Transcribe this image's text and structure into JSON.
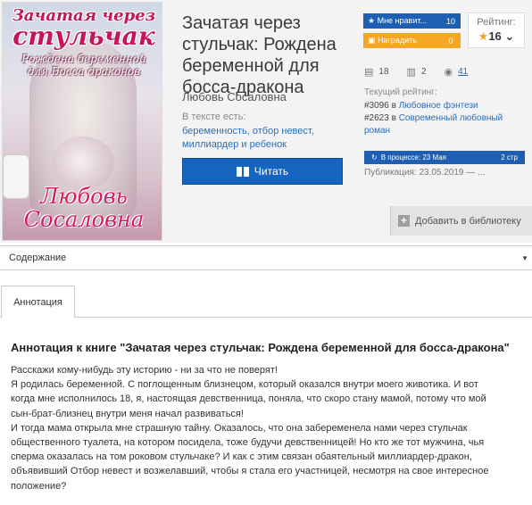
{
  "cover": {
    "title_line1": "Зачатая через",
    "title_line2": "стульчак",
    "subtitle_line1": "Рождена беременной",
    "subtitle_line2": "для Босса драконов",
    "author_line1": "Любовь",
    "author_line2": "Сосаловна"
  },
  "book": {
    "title": "Зачатая через стульчак: Рождена беременной для босса-дракона",
    "author": "Любовь Сосаловна",
    "tags_label": "В тексте есть:",
    "tags": "беременность, отбор невест, миллиардер и ребенок",
    "read_label": "Читать"
  },
  "actions": {
    "like_label": "Мне нравит...",
    "like_count": "10",
    "reward_label": "Наградить",
    "reward_count": "0",
    "add_library_label": "Добавить в библиотеку"
  },
  "rating": {
    "label": "Рейтинг:",
    "value": "16",
    "dropdown_icon": "chevron-down-icon"
  },
  "stats": {
    "comments": "18",
    "libraries": "2",
    "views": "41"
  },
  "current_rating": {
    "label": "Текущий рейтинг:",
    "rank1_num": "#3096 в",
    "rank1_genre": "Любовное фэнтези",
    "rank2_num": "#2623 в",
    "rank2_genre": "Современный любовный роман"
  },
  "status": {
    "progress_label": "В процессе: 23 Мая",
    "pages": "2 стр",
    "published": "Публикация: 23.05.2019 — ..."
  },
  "contents_label": "Содержание",
  "tabs": [
    {
      "label": "Аннотация"
    }
  ],
  "annotation": {
    "heading": "Аннотация к книге \"Зачатая через стульчак: Рождена беременной для босса-дракона\"",
    "line1": "Расскажи кому-нибудь эту историю - ни за что не поверят!",
    "line2": "Я родилась беременной. С поглощенным близнецом, который оказался внутри моего животика. И вот",
    "line3": "когда мне исполнилось 18, я, настоящая девственница, поняла, что скоро стану мамой, потому что мой",
    "line4": "сын-брат-близнец внутри меня начал развиваться!",
    "line5": "И тогда мама открыла мне страшную тайну. Оказалось, что она забеременела нами через стульчак",
    "line6": "общественного туалета, на котором посидела, тоже будучи девственницей! Но кто же тот мужчина, чья",
    "line7": "сперма оказалась на том роковом стульчаке? И как с этим связан обаятельный миллиардер-дракон,",
    "line8": "объявивший Отбор невест и возжелавший, чтобы я стала его участницей, несмотря на свое интересное",
    "line9": "положение?"
  },
  "colors": {
    "primary_blue": "#1565c0",
    "reward_orange": "#f5a623",
    "link_blue": "#2a6ebb",
    "cover_pink": "#c2185b"
  }
}
